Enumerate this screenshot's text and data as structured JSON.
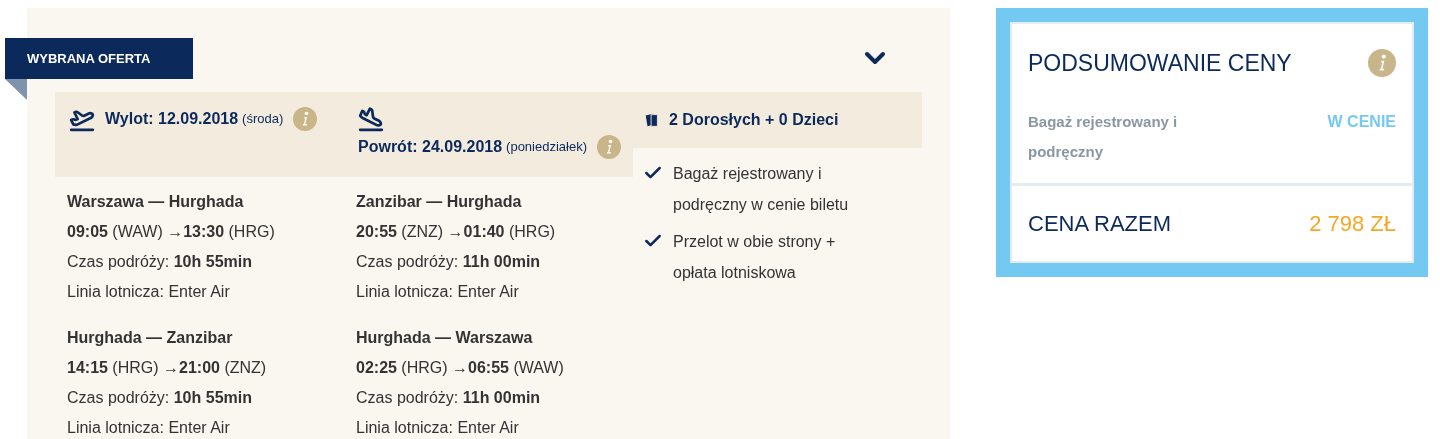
{
  "badge": "WYBRANA OFERTA",
  "flights": [
    {
      "kind": "departure",
      "label": "Wylot: 12.09.2018",
      "day": "(środa)",
      "segments": [
        {
          "route": "Warszawa — Hurghada",
          "times": "**09:05** (WAW) →**13:30** (HRG)",
          "duration": "Czas podróży: **10h 55min**",
          "airline": "Linia lotnicza: Enter Air"
        },
        {
          "route": "Hurghada — Zanzibar",
          "times": "**14:15** (HRG) →**21:00** (ZNZ)",
          "duration": "Czas podróży: **10h 55min**",
          "airline": "Linia lotnicza: Enter Air"
        }
      ]
    },
    {
      "kind": "return",
      "label": "Powrót: 24.09.2018",
      "day": "(poniedziałek)",
      "segments": [
        {
          "route": "Zanzibar — Hurghada",
          "times": "**20:55** (ZNZ) →**01:40** (HRG)",
          "duration": "Czas podróży: **11h 00min**",
          "airline": "Linia lotnicza: Enter Air"
        },
        {
          "route": "Hurghada — Warszawa",
          "times": "**02:25** (HRG) →**06:55** (WAW)",
          "duration": "Czas podróży: **11h 00min**",
          "airline": "Linia lotnicza: Enter Air"
        }
      ]
    }
  ],
  "passengers": "2 Dorosłych + 0 Dzieci",
  "inclusions": [
    "Bagaż rejestrowany i podręczny w cenie biletu",
    "Przelot w obie strony + opłata lotniskowa"
  ],
  "summary": {
    "title": "PODSUMOWANIE CENY",
    "rows": [
      {
        "label": "Bagaż rejestrowany i podręczny",
        "value": "W CENIE"
      }
    ],
    "total_label": "CENA RAZEM",
    "total": "2 798 ZŁ"
  }
}
